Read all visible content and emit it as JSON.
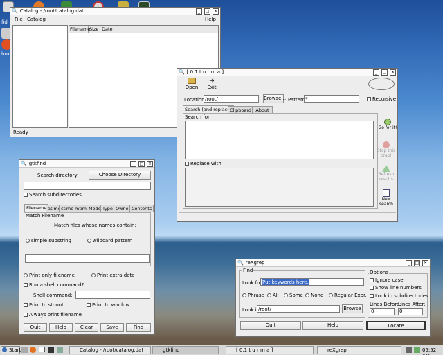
{
  "desktop": {
    "icon_labels": [
      "fid",
      "bro"
    ]
  },
  "catalog": {
    "title": "Catalog - /root/catalog.dat",
    "menu": [
      "File",
      "Catalog"
    ],
    "help": "Help",
    "columns": [
      "Filename",
      "Size",
      "Date"
    ],
    "status": "Ready"
  },
  "turma": {
    "title": "[ 0.1  t u r m a ]",
    "toolbar": {
      "open": "Open",
      "exit": "Exit"
    },
    "location_label": "Location:",
    "location_value": "/root/",
    "browse": "Browse...",
    "pattern_label": "Pattern:",
    "pattern_value": "*",
    "recursive": "Recursive",
    "tabs": [
      "Search (and replace)",
      "Clipboard",
      "About"
    ],
    "search_for": "Search for",
    "replace_with": "Replace with",
    "actions": [
      "Go for it!",
      "Stop this crap!",
      "Refresh results",
      "New search"
    ]
  },
  "gtkfind": {
    "title": "gtkfind",
    "search_dir_label": "Search directory:",
    "choose_dir": "Choose Directory",
    "search_subdirs": "Search subdirectories",
    "tabs": [
      "Filename",
      "atime",
      "ctime",
      "mtime",
      "Mode",
      "Type",
      "Owner",
      "Contents"
    ],
    "match_group": "Match Filename",
    "match_desc": "Match files whose names contain:",
    "simple_substring": "simple substring",
    "wildcard_pattern": "wildcard pattern",
    "print_only": "Print only filename",
    "print_extra": "Print extra data",
    "run_shell": "Run a shell command?",
    "shell_label": "Shell command:",
    "print_stdout": "Print to stdout",
    "print_window": "Print to window",
    "always_print": "Always print filename",
    "buttons": [
      "Quit",
      "Help",
      "Clear",
      "Save",
      "Find"
    ]
  },
  "rexgrep": {
    "title": "reXgrep",
    "find_group": "Find",
    "look_for_label": "Look for:",
    "look_for_value": "Put keywords here.",
    "modes": [
      "Phrase",
      "All",
      "Some",
      "None",
      "Regular Expr."
    ],
    "look_in_label": "Look in:",
    "look_in_value": "/root/",
    "browse": "Browse",
    "options_group": "Options",
    "ignore_case": "Ignore case",
    "show_line_numbers": "Show line numbers",
    "look_in_subdirs": "Look in subdirectories",
    "lines_before_label": "Lines Before:",
    "lines_before_value": "0",
    "lines_after_label": "Lines After:",
    "lines_after_value": "0",
    "buttons": [
      "Quit",
      "Help",
      "Locate"
    ]
  },
  "taskbar": {
    "start": "Start",
    "tasks": [
      "Catalog - /root/catalog.dat",
      "gtkfind",
      "[ 0.1  t u r m a ]",
      "reXgrep"
    ],
    "clock": "05:52 AM"
  }
}
